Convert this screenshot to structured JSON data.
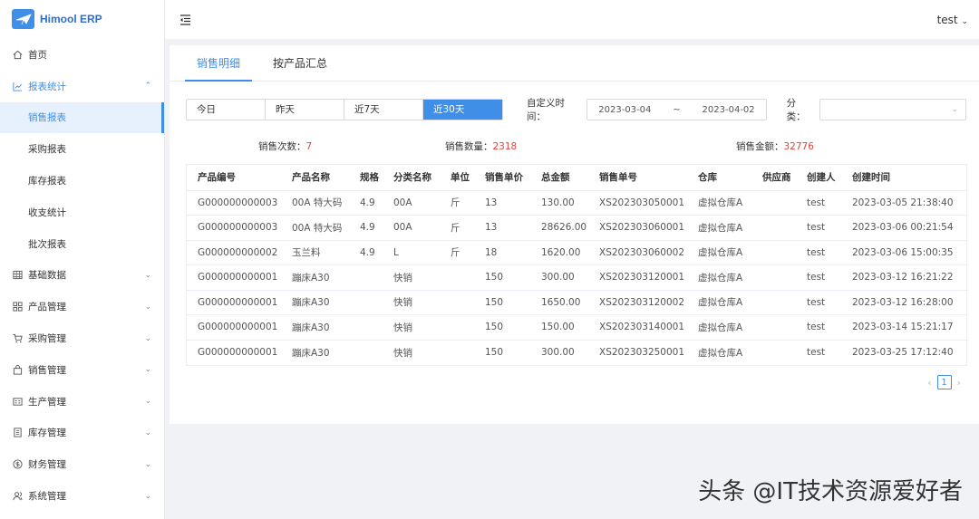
{
  "app": {
    "title": "Himool ERP",
    "user": "test"
  },
  "sidebar": {
    "items": [
      {
        "label": "首页",
        "icon": "home-icon",
        "arrow": ""
      },
      {
        "label": "报表统计",
        "icon": "chart-icon",
        "arrow": "⌃"
      },
      {
        "label": "销售报表"
      },
      {
        "label": "采购报表"
      },
      {
        "label": "库存报表"
      },
      {
        "label": "收支统计"
      },
      {
        "label": "批次报表"
      },
      {
        "label": "基础数据",
        "icon": "table-icon",
        "arrow": "⌄"
      },
      {
        "label": "产品管理",
        "icon": "appstore-icon",
        "arrow": "⌄"
      },
      {
        "label": "采购管理",
        "icon": "cart-icon",
        "arrow": "⌄"
      },
      {
        "label": "销售管理",
        "icon": "bag-icon",
        "arrow": "⌄"
      },
      {
        "label": "生产管理",
        "icon": "calculator-icon",
        "arrow": "⌄"
      },
      {
        "label": "库存管理",
        "icon": "file-icon",
        "arrow": "⌄"
      },
      {
        "label": "财务管理",
        "icon": "money-icon",
        "arrow": "⌄"
      },
      {
        "label": "系统管理",
        "icon": "users-icon",
        "arrow": "⌄"
      }
    ]
  },
  "tabs": [
    "销售明细",
    "按产品汇总"
  ],
  "filters": {
    "ranges": [
      "今日",
      "昨天",
      "近7天",
      "近30天"
    ],
    "custom_label": "自定义时间：",
    "start_date": "2023-03-04",
    "range_sep": "~",
    "end_date": "2023-04-02",
    "category_label": "分类："
  },
  "stats": {
    "count_label": "销售次数：",
    "count": "7",
    "qty_label": "销售数量：",
    "qty": "2318",
    "amount_label": "销售金额：",
    "amount": "32776"
  },
  "table": {
    "headers": [
      "产品编号",
      "产品名称",
      "规格",
      "分类名称",
      "单位",
      "销售单价",
      "总金额",
      "销售单号",
      "仓库",
      "供应商",
      "创建人",
      "创建时间"
    ],
    "rows": [
      [
        "G000000000003",
        "00A 特大码",
        "4.9",
        "00A",
        "斤",
        "13",
        "130.00",
        "XS202303050001",
        "虚拟仓库A",
        "",
        "test",
        "2023-03-05 21:38:40"
      ],
      [
        "G000000000003",
        "00A 特大码",
        "4.9",
        "00A",
        "斤",
        "13",
        "28626.00",
        "XS202303060001",
        "虚拟仓库A",
        "",
        "test",
        "2023-03-06 00:21:54"
      ],
      [
        "G000000000002",
        "玉兰料",
        "4.9",
        "L",
        "斤",
        "18",
        "1620.00",
        "XS202303060002",
        "虚拟仓库A",
        "",
        "test",
        "2023-03-06 15:00:35"
      ],
      [
        "G000000000001",
        "蹦床A30",
        "",
        "快销",
        "",
        "150",
        "300.00",
        "XS202303120001",
        "虚拟仓库A",
        "",
        "test",
        "2023-03-12 16:21:22"
      ],
      [
        "G000000000001",
        "蹦床A30",
        "",
        "快销",
        "",
        "150",
        "1650.00",
        "XS202303120002",
        "虚拟仓库A",
        "",
        "test",
        "2023-03-12 16:28:00"
      ],
      [
        "G000000000001",
        "蹦床A30",
        "",
        "快销",
        "",
        "150",
        "150.00",
        "XS202303140001",
        "虚拟仓库A",
        "",
        "test",
        "2023-03-14 15:21:17"
      ],
      [
        "G000000000001",
        "蹦床A30",
        "",
        "快销",
        "",
        "150",
        "300.00",
        "XS202303250001",
        "虚拟仓库A",
        "",
        "test",
        "2023-03-25 17:12:40"
      ]
    ]
  },
  "pagination": {
    "current": "1",
    "prev": "‹",
    "next": "›"
  },
  "watermark": "头条 @IT技术资源爱好者",
  "colors": {
    "accent": "#3f8ee8",
    "value_red": "#d9453c"
  }
}
